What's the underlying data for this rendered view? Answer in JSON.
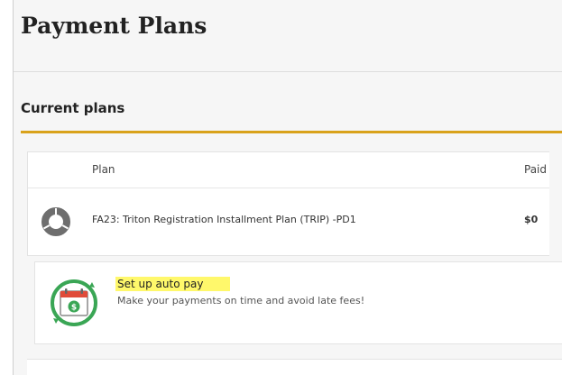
{
  "page": {
    "title": "Payment Plans"
  },
  "current_plans": {
    "section_title": "Current plans",
    "columns": {
      "plan": "Plan",
      "paid": "Paid"
    },
    "rows": [
      {
        "name": "FA23: Triton Registration Installment Plan (TRIP) -PD1",
        "paid": "$0",
        "icon": "progress-donut-icon"
      }
    ]
  },
  "autopay": {
    "title": "Set up auto pay",
    "description": "Make your payments on time and avoid late fees!",
    "icon": "calendar-dollar-icon",
    "highlight_color": "#fff86b"
  },
  "colors": {
    "accent": "#d9a21b",
    "icon_green": "#3aa655"
  }
}
